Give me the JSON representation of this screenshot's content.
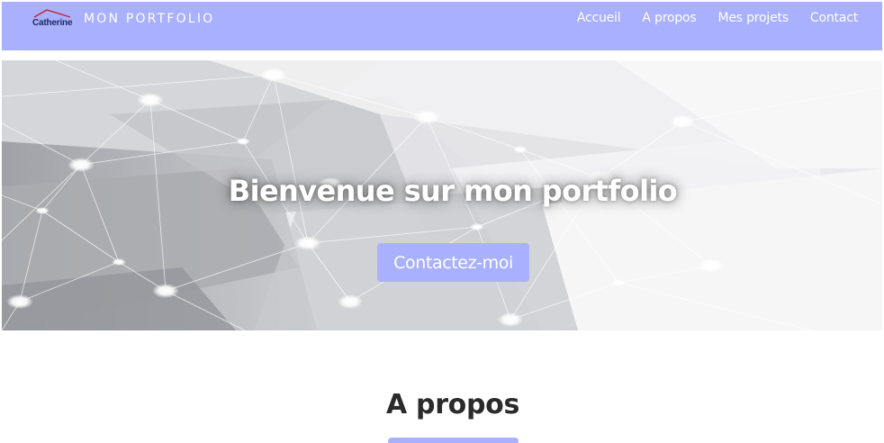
{
  "navbar": {
    "logo_text": "Catherine",
    "brand": "MON PORTFOLIO",
    "links": [
      {
        "label": "Accueil"
      },
      {
        "label": "A propos"
      },
      {
        "label": "Mes projets"
      },
      {
        "label": "Contact"
      }
    ]
  },
  "hero": {
    "title": "Bienvenue sur mon portfolio",
    "cta_label": "Contactez-moi"
  },
  "about": {
    "title": "A propos"
  },
  "colors": {
    "accent": "#a9b0fe",
    "hero_bg": "#e6e6e8",
    "text_dark": "#2b2b2b",
    "logo_text": "#1c2a5a",
    "logo_roof": "#c0262c"
  }
}
